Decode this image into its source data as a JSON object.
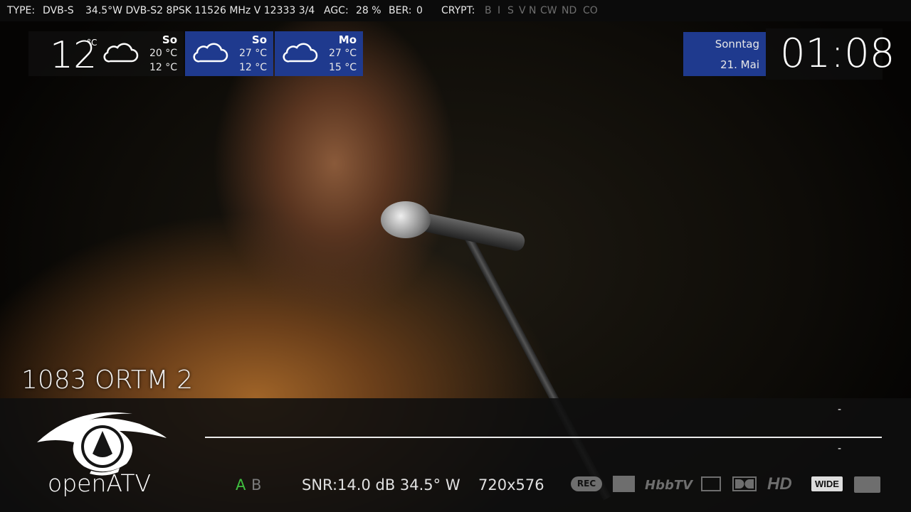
{
  "topbar": {
    "type_label": "TYPE:",
    "type_value": "DVB-S",
    "transponder": "34.5°W DVB-S2 8PSK 11526 MHz V 12333 3/4",
    "agc_label": "AGC:",
    "agc_value": "28 %",
    "ber_label": "BER:",
    "ber_value": "0",
    "crypt_label": "CRYPT:",
    "crypt_flags": [
      "B",
      "I",
      "S",
      "V",
      "N",
      "CW",
      "ND",
      "CO"
    ]
  },
  "weather": {
    "current_temp": "12",
    "current_unit": "°C",
    "current_icon": "cloud-icon",
    "today": {
      "day": "So",
      "high": "20 °C",
      "low": "12 °C"
    },
    "forecast": [
      {
        "day": "So",
        "high": "27 °C",
        "low": "12 °C",
        "icon": "cloud-icon"
      },
      {
        "day": "Mo",
        "high": "27 °C",
        "low": "15 °C",
        "icon": "cloud-icon"
      }
    ]
  },
  "date": {
    "weekday": "Sonntag",
    "date": "21. Mai"
  },
  "clock": {
    "time": "01:08"
  },
  "channel": {
    "name": "1083 ORTM 2"
  },
  "infobar": {
    "logo_text": "openATV",
    "event_now": "-",
    "event_next": "-",
    "progress": 1.0,
    "audio_a": "A",
    "audio_b": "B",
    "snr": "SNR:14.0 dB  34.5° W",
    "resolution": "720x576",
    "icons": [
      "rec-icon",
      "epg-icon",
      "hbbtv-icon",
      "teletext-icon",
      "dolby-icon",
      "hd-icon",
      "wide-icon",
      "subtitle-icon"
    ],
    "hbbtv_label": "HbbTV",
    "hd_label": "HD",
    "wide_label": "WIDE",
    "rec_label": "REC"
  },
  "colors": {
    "accent_blue": "#1f3a8e",
    "audio_active": "#3fbf3f",
    "inactive": "#6e6e6e"
  }
}
